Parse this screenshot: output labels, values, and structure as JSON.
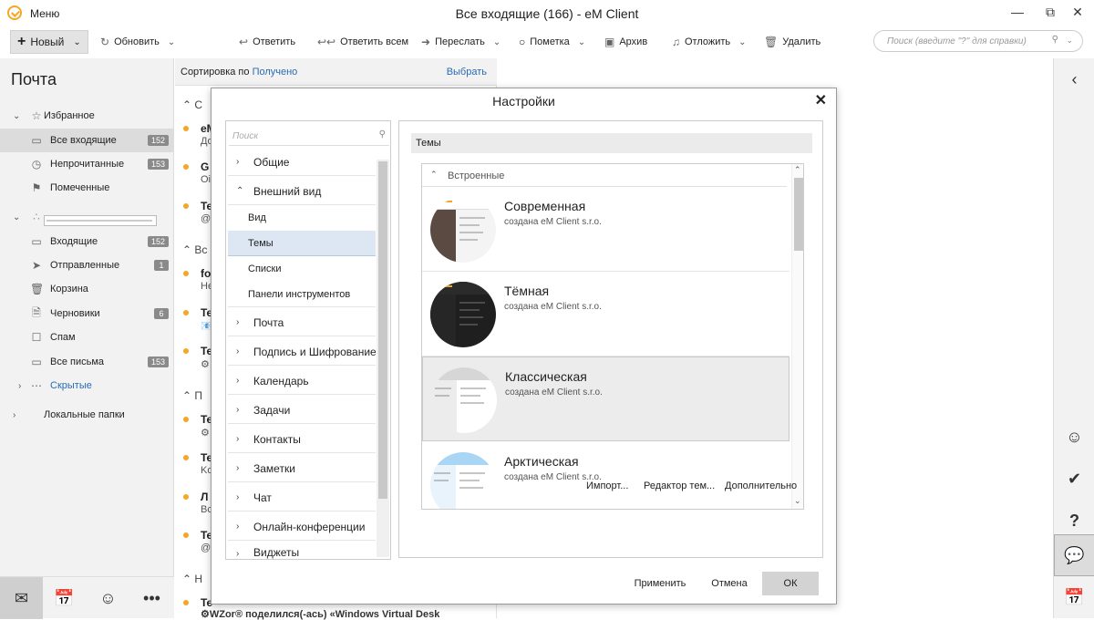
{
  "window": {
    "title": "Все входящие (166) - eM Client",
    "menu": "Меню"
  },
  "toolbar": {
    "new_label": "Новый",
    "refresh": "Обновить",
    "reply": "Ответить",
    "reply_all": "Ответить всем",
    "forward": "Переслать",
    "flag": "Пометка",
    "archive": "Архив",
    "snooze": "Отложить",
    "delete": "Удалить",
    "search_placeholder": "Поиск (введите \"?\" для справки)"
  },
  "sidebar": {
    "title": "Почта",
    "favorites_label": "Избранное",
    "items": [
      {
        "label": "Все входящие",
        "count": "152"
      },
      {
        "label": "Непрочитанные",
        "count": "153"
      },
      {
        "label": "Помеченные",
        "count": ""
      },
      {
        "label": "Входящие",
        "count": "152"
      },
      {
        "label": "Отправленные",
        "count": "1"
      },
      {
        "label": "Корзина",
        "count": ""
      },
      {
        "label": "Черновики",
        "count": "6"
      },
      {
        "label": "Спам",
        "count": ""
      },
      {
        "label": "Все письма",
        "count": "153"
      }
    ],
    "hidden_label": "Скрытые",
    "local_label": "Локальные папки"
  },
  "msglist": {
    "sort_prefix": "Сортировка по ",
    "sort_field": "Получено",
    "choose": "Выбрать",
    "groups": [
      "С",
      "Вс",
      "П",
      "Н"
    ],
    "messages": [
      {
        "a": "eM",
        "b": "Дo"
      },
      {
        "a": "G",
        "b": "Oi"
      },
      {
        "a": "Te",
        "b": "@"
      },
      {
        "a": "fo",
        "b": "He"
      },
      {
        "a": "Te",
        "b": "📧"
      },
      {
        "a": "Te",
        "b": "⚙"
      },
      {
        "a": "Te",
        "b": "⚙"
      },
      {
        "a": "Te",
        "b": "Ko"
      },
      {
        "a": "Л",
        "b": "Bc"
      },
      {
        "a": "Te",
        "b": "@"
      },
      {
        "a": "Te",
        "b": "⚙WZor® поделился(-ась) «Windows Virtual Desk"
      }
    ]
  },
  "dialog": {
    "title": "Настройки",
    "search_placeholder": "Поиск",
    "nav": [
      {
        "label": "Общие"
      },
      {
        "label": "Внешний вид"
      },
      {
        "label": "Вид"
      },
      {
        "label": "Темы"
      },
      {
        "label": "Списки"
      },
      {
        "label": "Панели инструментов"
      },
      {
        "label": "Почта"
      },
      {
        "label": "Подпись и Шифрование"
      },
      {
        "label": "Календарь"
      },
      {
        "label": "Задачи"
      },
      {
        "label": "Контакты"
      },
      {
        "label": "Заметки"
      },
      {
        "label": "Чат"
      },
      {
        "label": "Онлайн-конференции"
      },
      {
        "label": "Виджеты"
      }
    ],
    "section_header": "Темы",
    "builtin_label": "Встроенные",
    "themes": [
      {
        "name": "Современная",
        "author": "создана eM Client s.r.o."
      },
      {
        "name": "Тёмная",
        "author": "создана eM Client s.r.o."
      },
      {
        "name": "Классическая",
        "author": "создана eM Client s.r.o."
      },
      {
        "name": "Арктическая",
        "author": "создана eM Client s.r.o."
      }
    ],
    "import": "Импорт...",
    "editor": "Редактор тем...",
    "advanced": "Дополнительно",
    "apply": "Применить",
    "cancel": "Отмена",
    "ok": "ОК"
  },
  "colors": {
    "accent": "#f5a623",
    "selected_nav": "#dde7f3",
    "ok_button": "#d3d3d3"
  }
}
